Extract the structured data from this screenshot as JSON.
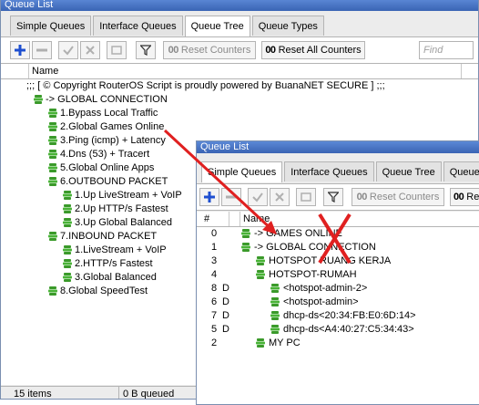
{
  "win1": {
    "title": "Queue List",
    "tabs": [
      "Simple Queues",
      "Interface Queues",
      "Queue Tree",
      "Queue Types"
    ],
    "active_tab": 2,
    "toolbar": {
      "reset_counters": "Reset Counters",
      "reset_all_counters": "Reset All Counters",
      "find_placeholder": "Find",
      "counter_glyph": "00"
    },
    "column_name": "Name",
    "rows": [
      {
        "label": ";;; [ © Copyright RouterOS Script is proudly powered by BuanaNET SECURE ] ;;;",
        "level": -1,
        "comment": true
      },
      {
        "label": "-> GLOBAL CONNECTION",
        "level": 0
      },
      {
        "label": "1.Bypass Local Traffic",
        "level": 1
      },
      {
        "label": "2.Global Games Online",
        "level": 1
      },
      {
        "label": "3.Ping (icmp) + Latency",
        "level": 1
      },
      {
        "label": "4.Dns (53) + Tracert",
        "level": 1
      },
      {
        "label": "5.Global Online Apps",
        "level": 1
      },
      {
        "label": "6.OUTBOUND PACKET",
        "level": 1
      },
      {
        "label": "1.Up LiveStream + VoIP",
        "level": 2
      },
      {
        "label": "2.Up HTTP/s Fastest",
        "level": 2
      },
      {
        "label": "3.Up Global Balanced",
        "level": 2
      },
      {
        "label": "7.INBOUND PACKET",
        "level": 1
      },
      {
        "label": "1.LiveStream + VoIP",
        "level": 2
      },
      {
        "label": "2.HTTP/s Fastest",
        "level": 2
      },
      {
        "label": "3.Global Balanced",
        "level": 2
      },
      {
        "label": "8.Global SpeedTest",
        "level": 1
      }
    ],
    "status": {
      "items": "15 items",
      "queued": "0 B queued"
    }
  },
  "win2": {
    "title": "Queue List",
    "tabs": [
      "Simple Queues",
      "Interface Queues",
      "Queue Tree",
      "Queue Typ"
    ],
    "active_tab": 0,
    "toolbar": {
      "reset_counters": "Reset Counters",
      "reset_all_counters": "Re",
      "counter_glyph": "00"
    },
    "columns": {
      "num": "#",
      "name": "Name"
    },
    "rows": [
      {
        "num": "0",
        "flag": "",
        "label": "-> GAMES ONLINE",
        "level": 0
      },
      {
        "num": "1",
        "flag": "",
        "label": "-> GLOBAL CONNECTION",
        "level": 0
      },
      {
        "num": "3",
        "flag": "",
        "label": "HOTSPOT RUANG KERJA",
        "level": 1
      },
      {
        "num": "4",
        "flag": "",
        "label": "HOTSPOT-RUMAH",
        "level": 1
      },
      {
        "num": "8",
        "flag": "D",
        "label": "<hotspot-admin-2>",
        "level": 2
      },
      {
        "num": "6",
        "flag": "D",
        "label": "<hotspot-admin>",
        "level": 2
      },
      {
        "num": "7",
        "flag": "D",
        "label": "dhcp-ds<20:34:FB:E0:6D:14>",
        "level": 2
      },
      {
        "num": "5",
        "flag": "D",
        "label": "dhcp-ds<A4:40:27:C5:34:43>",
        "level": 2
      },
      {
        "num": "2",
        "flag": "",
        "label": "MY PC",
        "level": 1
      }
    ]
  },
  "colors": {
    "accent_arrow": "#e02020",
    "queue_icon": "#3a9a2a",
    "title_bar": "#3a64b4"
  }
}
